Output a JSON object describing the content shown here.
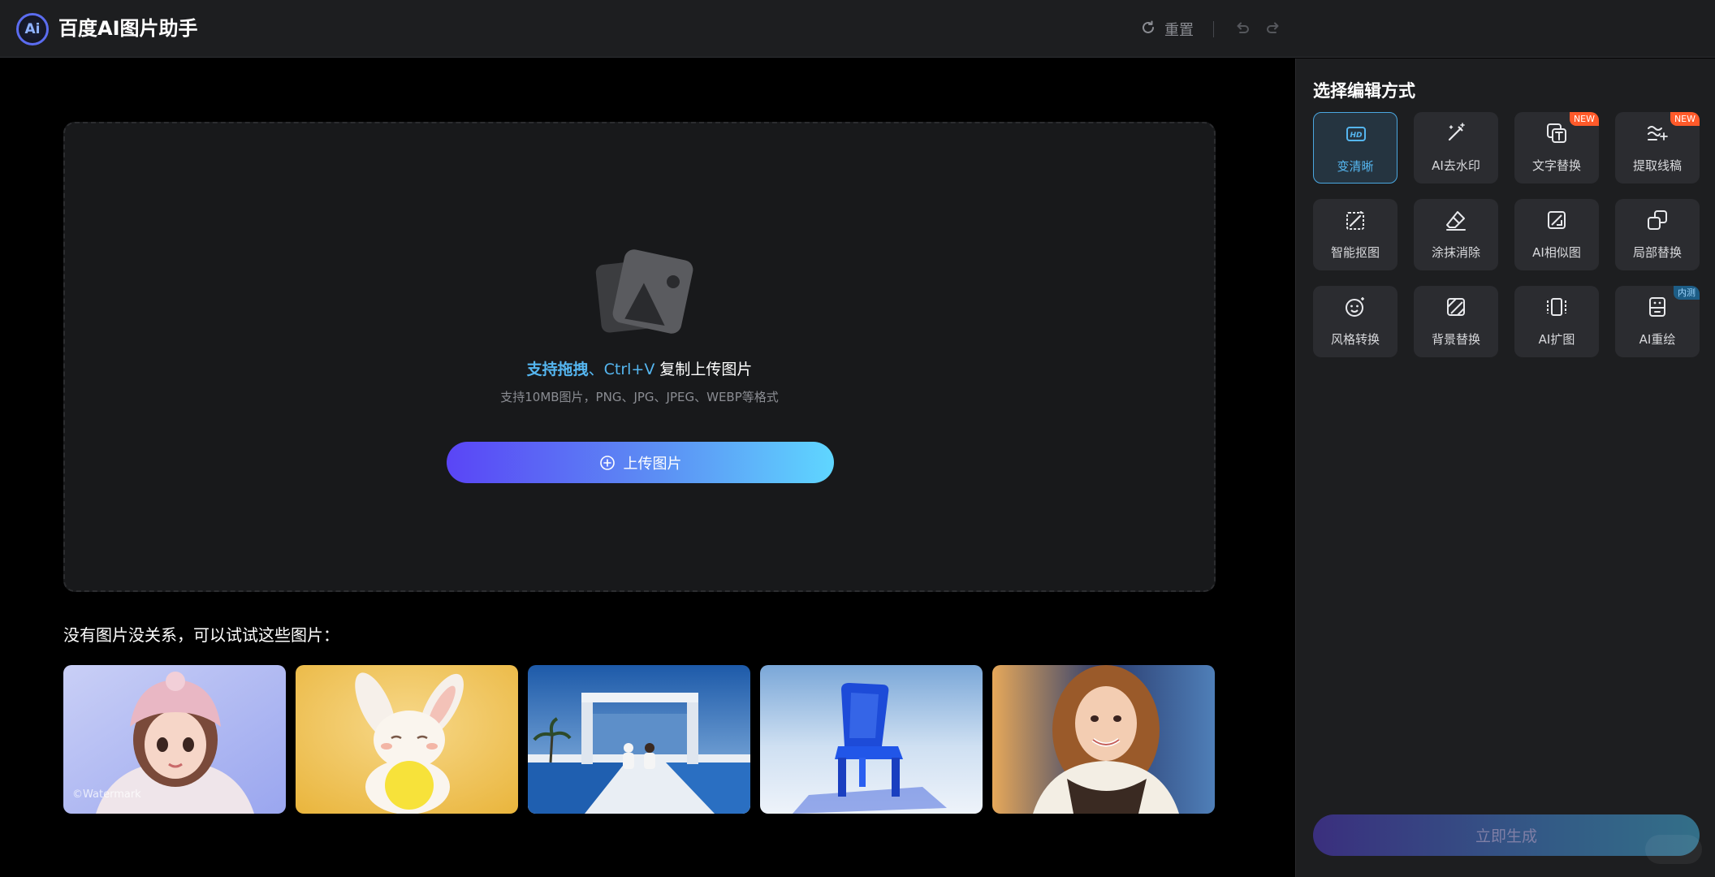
{
  "header": {
    "logo_text": "Ai",
    "title": "百度AI图片助手",
    "reset_label": "重置"
  },
  "upload": {
    "hint_drag": "支持拖拽",
    "hint_sep": "、",
    "hint_ctrlv": "Ctrl+V",
    "hint_rest": " 复制上传图片",
    "sub": "支持10MB图片，PNG、JPG、JPEG、WEBP等格式",
    "button_label": "上传图片"
  },
  "samples": {
    "title": "没有图片没关系，可以试试这些图片：",
    "watermark": "©Watermark",
    "items": [
      "girl-pink-hat",
      "white-bunny",
      "poolside-couple",
      "blue-chair",
      "smiling-woman"
    ]
  },
  "panel": {
    "title": "选择编辑方式",
    "tools": [
      {
        "label": "变清晰",
        "icon": "hd-icon",
        "active": true
      },
      {
        "label": "AI去水印",
        "icon": "magic-wand-icon"
      },
      {
        "label": "文字替换",
        "icon": "text-replace-icon",
        "badge": "NEW"
      },
      {
        "label": "提取线稿",
        "icon": "line-art-icon",
        "badge": "NEW"
      },
      {
        "label": "智能抠图",
        "icon": "cutout-icon"
      },
      {
        "label": "涂抹消除",
        "icon": "eraser-icon"
      },
      {
        "label": "AI相似图",
        "icon": "similar-image-icon"
      },
      {
        "label": "局部替换",
        "icon": "partial-replace-icon"
      },
      {
        "label": "风格转换",
        "icon": "style-face-icon"
      },
      {
        "label": "背景替换",
        "icon": "background-icon"
      },
      {
        "label": "AI扩图",
        "icon": "expand-icon"
      },
      {
        "label": "AI重绘",
        "icon": "redraw-icon",
        "badge": "内测"
      }
    ],
    "generate_label": "立即生成"
  },
  "colors": {
    "accent": "#55b6f0",
    "new_badge": "#ff5a2a",
    "beta_badge": "#1d5d86"
  }
}
